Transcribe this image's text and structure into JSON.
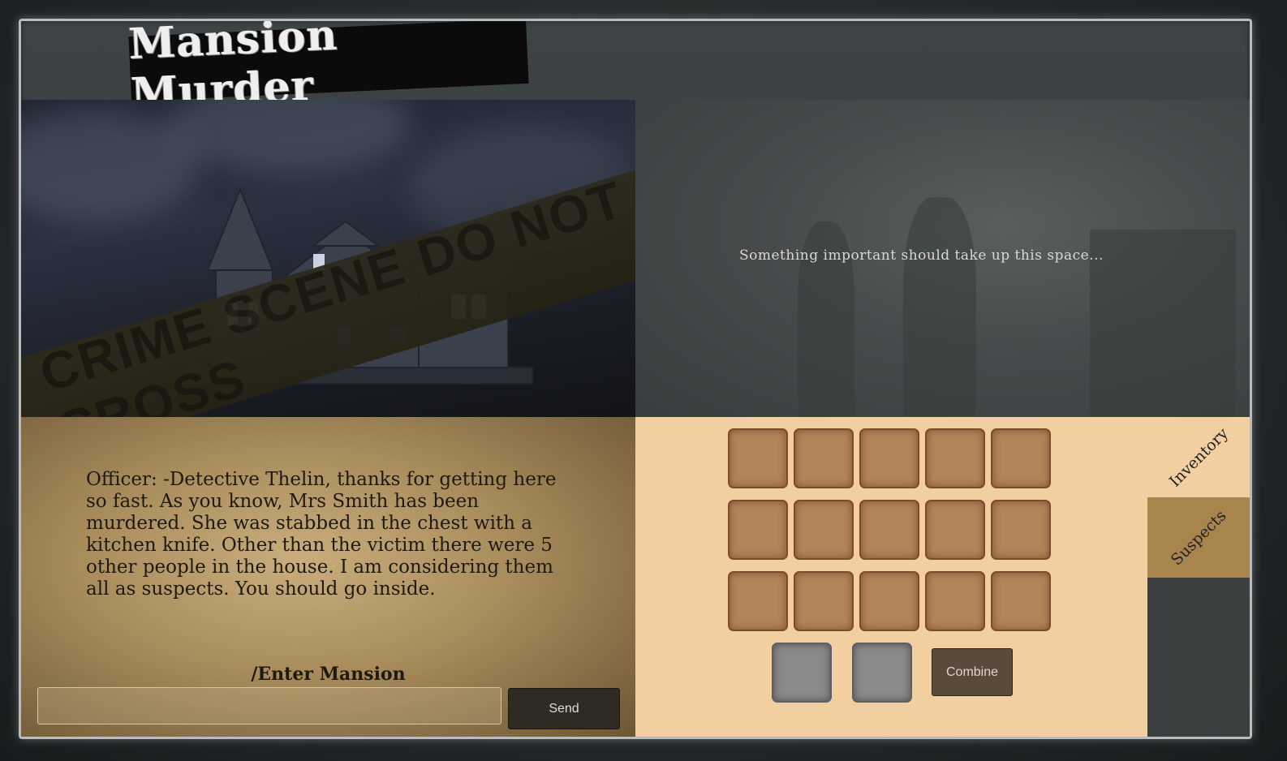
{
  "title": "Mansion Murder",
  "scene": {
    "tape_text": "CRIME SCENE DO NOT CROSS"
  },
  "info_panel": {
    "text": "Something important should take up this space..."
  },
  "dialog": {
    "story": "Officer: -Detective Thelin, thanks for getting here so fast. As you know, Mrs Smith has been murdered. She was stabbed in the chest with a kitchen knife. Other than the victim there were 5 other people in the house. I am considering them all as suspects. You should go inside.",
    "command_option": "/Enter Mansion",
    "input_value": "",
    "send_label": "Send"
  },
  "inventory": {
    "slot_rows": 3,
    "slot_cols": 5,
    "combine_slots": 2,
    "combine_label": "Combine"
  },
  "tabs": [
    {
      "label": "Inventory",
      "active": true
    },
    {
      "label": "Suspects",
      "active": false
    }
  ],
  "colors": {
    "inventory_bg": "#f2cfa0",
    "slot": "#b1865a",
    "combine_slot": "#8a8a8a",
    "suspects_tab": "#a7854c"
  }
}
